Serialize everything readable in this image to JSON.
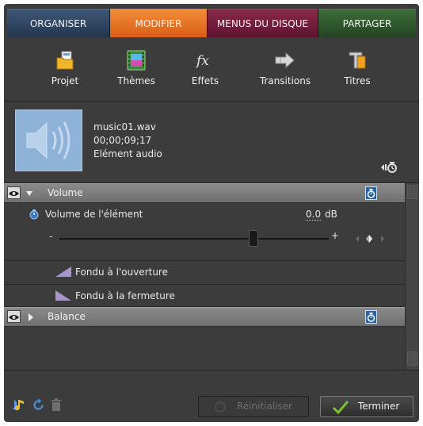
{
  "tabs": [
    {
      "label": "ORGANISER",
      "color": "#2f4766"
    },
    {
      "label": "MODIFIER",
      "color": "#e67124"
    },
    {
      "label": "MENUS DU DISQUE",
      "color": "#70193a"
    },
    {
      "label": "PARTAGER",
      "color": "#305a2d"
    }
  ],
  "toolbar": [
    {
      "label": "Projet",
      "icon": "project-folder-icon"
    },
    {
      "label": "Thèmes",
      "icon": "themes-film-icon"
    },
    {
      "label": "Effets",
      "icon": "effects-fx-icon"
    },
    {
      "label": "Transitions",
      "icon": "transitions-arrow-icon"
    },
    {
      "label": "Titres",
      "icon": "titles-t-icon"
    }
  ],
  "clip": {
    "filename": "music01.wav",
    "timecode": "00;00;09;17",
    "type": "Elément audio"
  },
  "effects": {
    "volume": {
      "title": "Volume",
      "param_label": "Volume de l'élément",
      "value": "0.0",
      "unit": "dB",
      "slider_min": "-",
      "slider_max": "+",
      "slider_position": 0.72
    },
    "fade_in": "Fondu à l'ouverture",
    "fade_out": "Fondu à la fermeture",
    "balance": {
      "title": "Balance"
    }
  },
  "footer": {
    "reset_label": "Réinitialiser",
    "done_label": "Terminer"
  },
  "colors": {
    "panel": "#3c3c3c",
    "section": "#7d7d7d",
    "accent_blue": "#2a64a6",
    "check_green": "#7ec232"
  }
}
